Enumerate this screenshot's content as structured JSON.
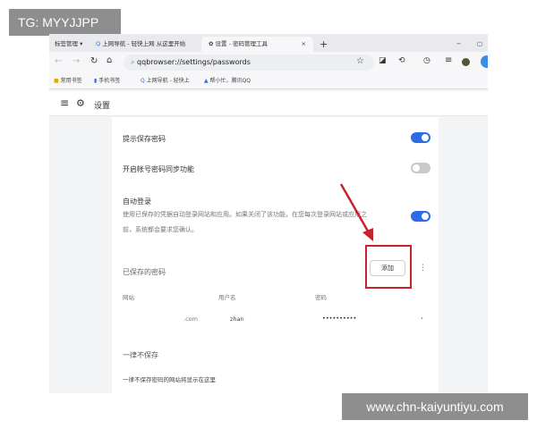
{
  "overlay_top": "TG: MYYJJPP",
  "overlay_bottom": "www.chn-kaiyuntiyu.com",
  "tabs": {
    "bookmark_manager": "标签管理 ▾",
    "tab1": "上网导航 - 轻快上网 从这里开始",
    "tab2": "设置 - 密码管理工具",
    "close": "×",
    "new": "+"
  },
  "window": {
    "minimize": "−",
    "maximize": "▢"
  },
  "address": {
    "url": "qqbrowser://settings/passwords"
  },
  "bookmarks": [
    "常用书签",
    "手机书签",
    "上网导航 - 轻快上",
    "帮小忙，腾讯QQ"
  ],
  "header": {
    "title": "设置"
  },
  "settings": {
    "prompt_save": "提示保存密码",
    "sync": "开启帐号密码同步功能",
    "auto_login": "自动登录",
    "auto_login_desc1": "使用已保存的凭据自动登录网站和应用。如果关闭了该功能，在您每次登录网站或应用之",
    "auto_login_desc2": "前，系统都会要求您确认。",
    "saved": "已保存的密码",
    "add": "添加",
    "columns": [
      "网站",
      "用户名",
      "密码"
    ],
    "entry": {
      "site": ".com",
      "user": "zhan",
      "password": "••••••••••"
    },
    "never": "一律不保存",
    "never_desc": "一律不保存密码的网站将显示在这里"
  },
  "toggles": {
    "prompt_save": true,
    "sync": false,
    "auto_login": true
  },
  "colors": {
    "accent": "#2e6be6",
    "highlight": "#c8232c"
  }
}
